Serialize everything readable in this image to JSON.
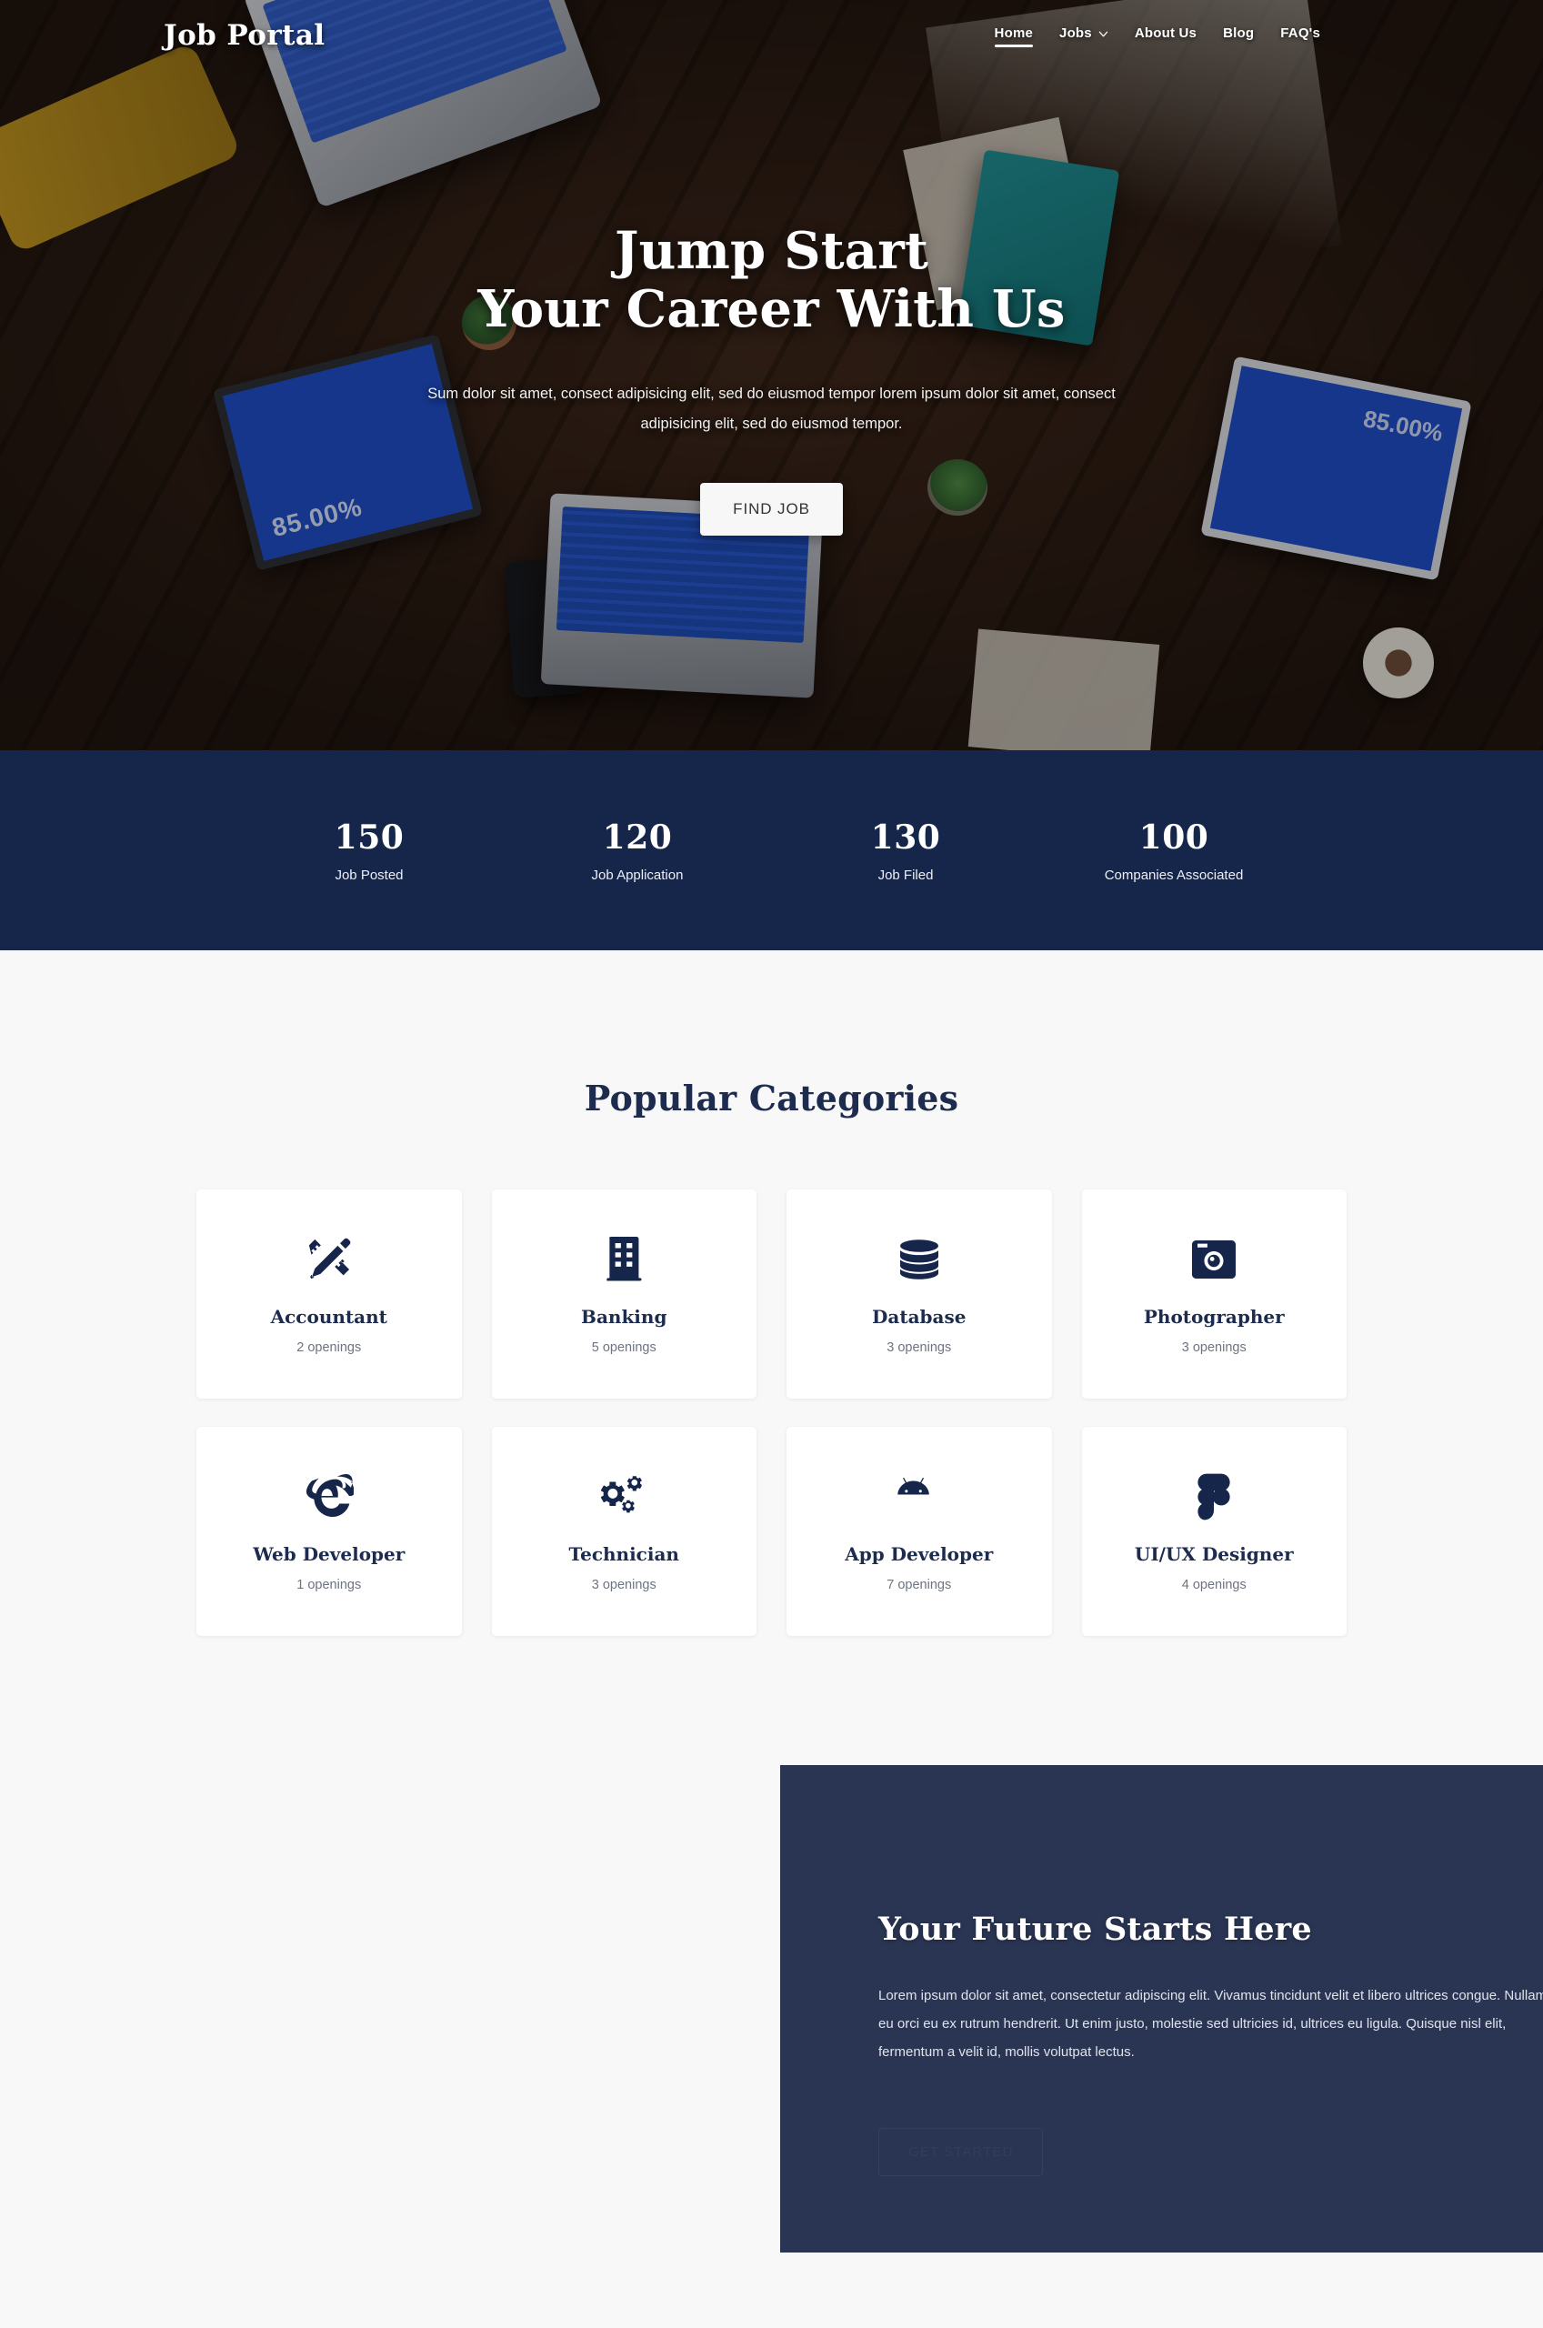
{
  "brand": {
    "name": "Job Portal"
  },
  "nav": {
    "items": [
      {
        "label": "Home",
        "active": true,
        "has_dropdown": false
      },
      {
        "label": "Jobs",
        "active": false,
        "has_dropdown": true
      },
      {
        "label": "About Us",
        "active": false,
        "has_dropdown": false
      },
      {
        "label": "Blog",
        "active": false,
        "has_dropdown": false
      },
      {
        "label": "FAQ's",
        "active": false,
        "has_dropdown": false
      }
    ]
  },
  "hero": {
    "title_line1": "Jump Start",
    "title_line2": "Your Career With Us",
    "subtitle": "Sum dolor sit amet, consect adipisicing elit, sed do eiusmod tempor lorem ipsum dolor sit amet, consect adipisicing elit, sed do eiusmod tempor.",
    "cta_label": "FIND JOB"
  },
  "stats": {
    "items": [
      {
        "value": "150",
        "label": "Job Posted"
      },
      {
        "value": "120",
        "label": "Job Application"
      },
      {
        "value": "130",
        "label": "Job Filed"
      },
      {
        "value": "100",
        "label": "Companies Associated"
      }
    ]
  },
  "categories": {
    "title": "Popular Categories",
    "items": [
      {
        "name": "Accountant",
        "openings": "2 openings",
        "icon": "pen-ruler-icon"
      },
      {
        "name": "Banking",
        "openings": "5 openings",
        "icon": "building-icon"
      },
      {
        "name": "Database",
        "openings": "3 openings",
        "icon": "database-icon"
      },
      {
        "name": "Photographer",
        "openings": "3 openings",
        "icon": "camera-retro-icon"
      },
      {
        "name": "Web Developer",
        "openings": "1 openings",
        "icon": "internet-explorer-icon"
      },
      {
        "name": "Technician",
        "openings": "3 openings",
        "icon": "cogs-icon"
      },
      {
        "name": "App Developer",
        "openings": "7 openings",
        "icon": "android-icon"
      },
      {
        "name": "UI/UX Designer",
        "openings": "4 openings",
        "icon": "figma-icon"
      }
    ]
  },
  "cta": {
    "title": "Your Future Starts Here",
    "text": "Lorem ipsum dolor sit amet, consectetur adipiscing elit. Vivamus tincidunt velit et libero ultrices congue. Nullam eu orci eu ex rutrum hendrerit. Ut enim justo, molestie sed ultricies id, ultrices eu ligula. Quisque nisl elit, fermentum a velit id, mollis volutpat lectus.",
    "button_label": "GET STARTED"
  },
  "colors": {
    "navy": "#16254a",
    "panel_navy": "#2a3553",
    "page_bg": "#f8f8f8",
    "card_bg": "#ffffff",
    "heading": "#1d2c4e",
    "muted_text": "#6d7480"
  }
}
